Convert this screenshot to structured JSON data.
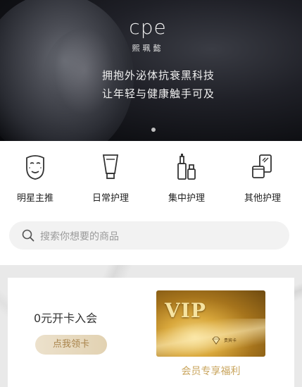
{
  "banner": {
    "brand_logo": "cpe",
    "brand_sub": "熙珮懿",
    "slogan_line1": "拥抱外泌体抗衰黑科技",
    "slogan_line2": "让年轻与健康触手可及"
  },
  "categories": [
    {
      "label": "明星主推",
      "icon": "face-mask-icon"
    },
    {
      "label": "日常护理",
      "icon": "tube-icon"
    },
    {
      "label": "集中护理",
      "icon": "bottles-icon"
    },
    {
      "label": "其他护理",
      "icon": "jars-icon"
    }
  ],
  "search": {
    "placeholder": "搜索你想要的商品",
    "icon": "search-icon"
  },
  "member": {
    "title": "0元开卡入会",
    "claim_button": "点我领卡",
    "vip_label": "VIP",
    "vip_card_text": "贵宾卡",
    "caption": "会员专享福利"
  },
  "colors": {
    "gold": "#c9a55e",
    "banner_bg": "#0f1014",
    "search_bg": "#f2f2f2"
  }
}
